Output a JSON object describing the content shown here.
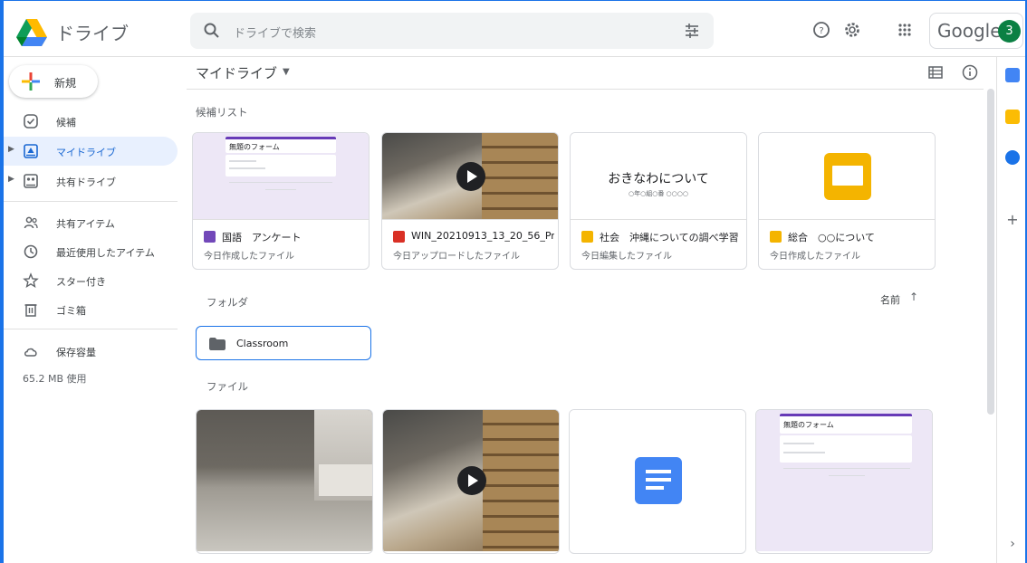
{
  "app": {
    "title": "ドライブ",
    "search_placeholder": "ドライブで検索",
    "google_label": "Google",
    "avatar_initial": "3"
  },
  "sidebar": {
    "new_label": "新規",
    "items": [
      {
        "label": "候補",
        "icon": "check-circle-icon"
      },
      {
        "label": "マイドライブ",
        "icon": "my-drive-icon",
        "active": true
      },
      {
        "label": "共有ドライブ",
        "icon": "shared-drives-icon"
      },
      {
        "label": "共有アイテム",
        "icon": "people-icon"
      },
      {
        "label": "最近使用したアイテム",
        "icon": "clock-icon"
      },
      {
        "label": "スター付き",
        "icon": "star-icon"
      },
      {
        "label": "ゴミ箱",
        "icon": "trash-icon"
      },
      {
        "label": "保存容量",
        "icon": "cloud-icon"
      }
    ],
    "usage": "65.2 MB 使用"
  },
  "main": {
    "breadcrumb": "マイドライブ",
    "suggested_heading": "候補リスト",
    "suggested": [
      {
        "name": "国語　アンケート",
        "sub": "今日作成したファイル",
        "type": "form",
        "color": "#7248b9"
      },
      {
        "name": "WIN_20210913_13_20_56_Pr...",
        "sub": "今日アップロードしたファイル",
        "type": "video",
        "color": "#d93025"
      },
      {
        "name": "社会　沖縄についての調べ学習",
        "sub": "今日編集したファイル",
        "type": "slides",
        "color": "#f4b400",
        "slide_title": "おきなわについて",
        "slide_sub": "○年○組○番 ○○○○"
      },
      {
        "name": "総合　○○について",
        "sub": "今日作成したファイル",
        "type": "slides",
        "color": "#f4b400"
      }
    ],
    "folders_heading": "フォルダ",
    "sort_label": "名前",
    "folders": [
      {
        "name": "Classroom"
      }
    ],
    "files_heading": "ファイル",
    "form_thumb_title": "無題のフォーム"
  },
  "colors": {
    "accent": "#1a73e8",
    "active_bg": "#e8f0fe",
    "active_text": "#1967d2"
  }
}
